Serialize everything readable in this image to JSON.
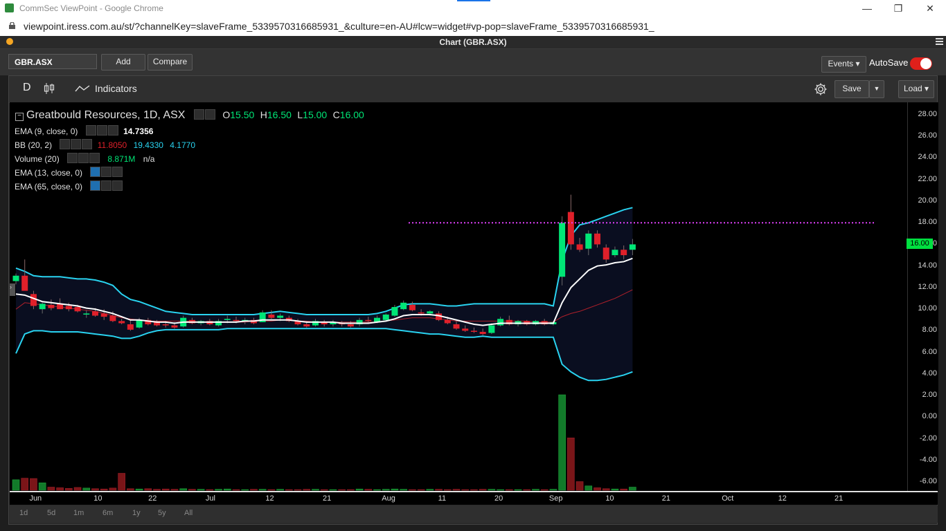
{
  "browser": {
    "title": "CommSec ViewPoint - Google Chrome",
    "url": "viewpoint.iress.com.au/st/?channelKey=slaveFrame_5339570316685931_&culture=en-AU#lcw=widget#vp-pop=slaveFrame_5339570316685931_",
    "minimize": "—",
    "restore": "❐",
    "close": "✕"
  },
  "app": {
    "title": "Chart (GBR.ASX)"
  },
  "toolbar": {
    "symbol": "GBR.ASX",
    "add_label": "Add",
    "compare_label": "Compare",
    "events_label": "Events ▾",
    "autosave_label": "AutoSave",
    "autosave_on": true
  },
  "chart_toolbar": {
    "period": "D",
    "indicators_label": "Indicators",
    "save_label": "Save",
    "save_dropdown": "▼",
    "load_label": "Load ▾"
  },
  "legend": {
    "instrument": "Greatbould Resources, 1D, ASX",
    "ohlc": {
      "o_label": "O",
      "o": "15.50",
      "h_label": "H",
      "h": "16.50",
      "l_label": "L",
      "l": "15.00",
      "c_label": "C",
      "c": "16.00"
    },
    "studies": [
      {
        "name": "EMA (9, close, 0)",
        "values": [
          "14.7356"
        ]
      },
      {
        "name": "BB (20, 2)",
        "values": [
          "11.8050",
          "19.4330",
          "4.1770"
        ]
      },
      {
        "name": "Volume (20)",
        "values": [
          "8.871M",
          "n/a"
        ]
      },
      {
        "name": "EMA (13, close, 0)",
        "values": []
      },
      {
        "name": "EMA (65, close, 0)",
        "values": []
      }
    ],
    "colors": {
      "up": "#00e676",
      "down": "#e0202a",
      "bb_band": "#29d3f0",
      "bb_mid": "#b0202a",
      "ema9": "#ffffff",
      "last_price_line": "#e040fb"
    }
  },
  "chart_data": {
    "type": "candlestick",
    "y_ticks": [
      "28.00",
      "26.00",
      "24.00",
      "22.00",
      "20.00",
      "18.00",
      "16.00",
      "14.00",
      "12.00",
      "10.00",
      "8.00",
      "6.00",
      "4.00",
      "2.00",
      "0.00",
      "-2.00",
      "-4.00",
      "-6.00"
    ],
    "x_ticks": [
      "Jun",
      "10",
      "22",
      "Jul",
      "12",
      "21",
      "Aug",
      "11",
      "20",
      "Sep",
      "10",
      "21",
      "Oct",
      "12",
      "21"
    ],
    "ylim": [
      -7,
      29
    ],
    "last_price": "16.00",
    "reference_line": 18.0,
    "candles": [
      {
        "o": 12.6,
        "h": 13.3,
        "l": 12.3,
        "c": 13.1
      },
      {
        "o": 13.1,
        "h": 14.6,
        "l": 11.8,
        "c": 11.7
      },
      {
        "o": 11.4,
        "h": 11.7,
        "l": 10.0,
        "c": 10.3
      },
      {
        "o": 10.0,
        "h": 10.6,
        "l": 9.6,
        "c": 10.5
      },
      {
        "o": 10.4,
        "h": 10.9,
        "l": 9.9,
        "c": 10.1
      },
      {
        "o": 10.5,
        "h": 11.0,
        "l": 10.0,
        "c": 10.0
      },
      {
        "o": 10.3,
        "h": 10.6,
        "l": 9.8,
        "c": 10.0
      },
      {
        "o": 10.2,
        "h": 10.4,
        "l": 9.7,
        "c": 9.8
      },
      {
        "o": 9.5,
        "h": 9.9,
        "l": 9.2,
        "c": 9.6
      },
      {
        "o": 9.8,
        "h": 10.1,
        "l": 9.3,
        "c": 9.4
      },
      {
        "o": 9.6,
        "h": 10.0,
        "l": 9.0,
        "c": 9.3
      },
      {
        "o": 9.4,
        "h": 9.8,
        "l": 8.8,
        "c": 8.9
      },
      {
        "o": 8.9,
        "h": 9.1,
        "l": 8.6,
        "c": 8.7
      },
      {
        "o": 8.6,
        "h": 9.0,
        "l": 8.0,
        "c": 8.1
      },
      {
        "o": 8.3,
        "h": 9.2,
        "l": 8.2,
        "c": 9.0
      },
      {
        "o": 9.0,
        "h": 9.2,
        "l": 8.5,
        "c": 8.6
      },
      {
        "o": 8.8,
        "h": 9.0,
        "l": 8.4,
        "c": 8.5
      },
      {
        "o": 8.6,
        "h": 8.9,
        "l": 8.3,
        "c": 8.5
      },
      {
        "o": 8.5,
        "h": 8.8,
        "l": 8.2,
        "c": 8.3
      },
      {
        "o": 8.4,
        "h": 9.4,
        "l": 8.3,
        "c": 9.2
      },
      {
        "o": 9.0,
        "h": 9.2,
        "l": 8.6,
        "c": 8.7
      },
      {
        "o": 8.7,
        "h": 9.0,
        "l": 8.5,
        "c": 8.9
      },
      {
        "o": 8.9,
        "h": 9.1,
        "l": 8.5,
        "c": 8.6
      },
      {
        "o": 8.5,
        "h": 9.1,
        "l": 8.4,
        "c": 8.9
      },
      {
        "o": 9.0,
        "h": 9.4,
        "l": 8.7,
        "c": 9.1
      },
      {
        "o": 9.0,
        "h": 9.3,
        "l": 8.7,
        "c": 8.9
      },
      {
        "o": 8.9,
        "h": 9.2,
        "l": 8.6,
        "c": 9.0
      },
      {
        "o": 9.0,
        "h": 9.2,
        "l": 8.6,
        "c": 8.7
      },
      {
        "o": 8.8,
        "h": 9.9,
        "l": 8.8,
        "c": 9.7
      },
      {
        "o": 9.5,
        "h": 9.9,
        "l": 9.1,
        "c": 9.2
      },
      {
        "o": 9.2,
        "h": 9.6,
        "l": 8.9,
        "c": 9.4
      },
      {
        "o": 9.2,
        "h": 9.4,
        "l": 8.8,
        "c": 8.9
      },
      {
        "o": 8.9,
        "h": 9.1,
        "l": 8.5,
        "c": 8.6
      },
      {
        "o": 8.6,
        "h": 8.9,
        "l": 8.3,
        "c": 8.4
      },
      {
        "o": 8.5,
        "h": 9.1,
        "l": 8.4,
        "c": 8.9
      },
      {
        "o": 8.8,
        "h": 9.0,
        "l": 8.4,
        "c": 8.6
      },
      {
        "o": 8.6,
        "h": 9.0,
        "l": 8.4,
        "c": 8.8
      },
      {
        "o": 8.7,
        "h": 8.9,
        "l": 8.4,
        "c": 8.6
      },
      {
        "o": 8.6,
        "h": 8.9,
        "l": 8.3,
        "c": 8.4
      },
      {
        "o": 8.6,
        "h": 9.2,
        "l": 8.4,
        "c": 9.0
      },
      {
        "o": 9.0,
        "h": 9.3,
        "l": 8.7,
        "c": 8.9
      },
      {
        "o": 8.8,
        "h": 9.4,
        "l": 8.7,
        "c": 9.2
      },
      {
        "o": 9.0,
        "h": 9.6,
        "l": 8.9,
        "c": 9.5
      },
      {
        "o": 9.4,
        "h": 10.4,
        "l": 9.3,
        "c": 10.2
      },
      {
        "o": 10.0,
        "h": 10.8,
        "l": 9.9,
        "c": 10.6
      },
      {
        "o": 10.4,
        "h": 10.7,
        "l": 9.8,
        "c": 9.9
      },
      {
        "o": 9.7,
        "h": 10.0,
        "l": 9.4,
        "c": 9.6
      },
      {
        "o": 9.6,
        "h": 9.9,
        "l": 9.4,
        "c": 9.8
      },
      {
        "o": 9.6,
        "h": 9.8,
        "l": 8.9,
        "c": 9.0
      },
      {
        "o": 9.0,
        "h": 9.3,
        "l": 8.6,
        "c": 8.7
      },
      {
        "o": 8.6,
        "h": 8.9,
        "l": 8.1,
        "c": 8.2
      },
      {
        "o": 8.2,
        "h": 8.5,
        "l": 7.9,
        "c": 8.0
      },
      {
        "o": 8.0,
        "h": 8.3,
        "l": 7.8,
        "c": 7.9
      },
      {
        "o": 7.9,
        "h": 8.2,
        "l": 7.6,
        "c": 7.7
      },
      {
        "o": 7.8,
        "h": 8.7,
        "l": 7.7,
        "c": 8.5
      },
      {
        "o": 8.5,
        "h": 9.3,
        "l": 8.4,
        "c": 9.1
      },
      {
        "o": 9.0,
        "h": 9.4,
        "l": 8.5,
        "c": 8.6
      },
      {
        "o": 8.6,
        "h": 9.0,
        "l": 8.4,
        "c": 8.9
      },
      {
        "o": 8.9,
        "h": 9.0,
        "l": 8.5,
        "c": 8.6
      },
      {
        "o": 8.6,
        "h": 9.0,
        "l": 8.5,
        "c": 8.9
      },
      {
        "o": 8.9,
        "h": 9.1,
        "l": 8.5,
        "c": 8.6
      },
      {
        "o": 8.6,
        "h": 8.9,
        "l": 8.5,
        "c": 8.8
      },
      {
        "o": 13.0,
        "h": 18.6,
        "l": 12.2,
        "c": 18.0
      },
      {
        "o": 19.0,
        "h": 20.6,
        "l": 15.5,
        "c": 16.0
      },
      {
        "o": 16.0,
        "h": 16.6,
        "l": 15.3,
        "c": 15.5
      },
      {
        "o": 15.6,
        "h": 17.3,
        "l": 15.0,
        "c": 17.0
      },
      {
        "o": 17.0,
        "h": 17.3,
        "l": 15.7,
        "c": 16.0
      },
      {
        "o": 15.7,
        "h": 16.0,
        "l": 14.3,
        "c": 14.6
      },
      {
        "o": 15.0,
        "h": 15.8,
        "l": 14.8,
        "c": 15.5
      },
      {
        "o": 15.5,
        "h": 15.9,
        "l": 14.6,
        "c": 15.0
      },
      {
        "o": 15.5,
        "h": 16.5,
        "l": 15.0,
        "c": 16.0
      }
    ],
    "volume": [
      3.4,
      3.9,
      3.8,
      2.4,
      1.0,
      0.8,
      0.6,
      0.9,
      0.7,
      0.5,
      0.4,
      0.7,
      5.5,
      0.5,
      0.4,
      0.5,
      0.3,
      0.4,
      0.3,
      0.5,
      0.3,
      0.3,
      0.2,
      0.3,
      0.4,
      0.2,
      0.2,
      0.3,
      0.3,
      0.2,
      0.3,
      0.2,
      0.2,
      0.3,
      0.3,
      0.2,
      0.2,
      0.2,
      0.2,
      0.4,
      0.3,
      0.2,
      0.3,
      0.4,
      0.3,
      0.2,
      0.2,
      0.3,
      0.3,
      0.2,
      0.3,
      0.2,
      0.2,
      0.3,
      0.3,
      0.2,
      0.2,
      0.2,
      0.2,
      0.3,
      0.2,
      0.3,
      31.0,
      17.0,
      2.8,
      1.4,
      0.8,
      0.5,
      0.4,
      0.4,
      1.0
    ],
    "volume_max": 31.0,
    "ema9": [
      11.4,
      11.3,
      11.0,
      10.7,
      10.6,
      10.5,
      10.4,
      10.3,
      10.1,
      10.0,
      9.8,
      9.6,
      9.3,
      9.0,
      9.0,
      8.9,
      8.8,
      8.8,
      8.7,
      8.8,
      8.8,
      8.8,
      8.8,
      8.8,
      8.8,
      8.8,
      8.9,
      8.9,
      9.0,
      9.0,
      9.0,
      9.0,
      8.9,
      8.8,
      8.8,
      8.8,
      8.8,
      8.7,
      8.7,
      8.7,
      8.7,
      8.8,
      8.9,
      9.1,
      9.4,
      9.5,
      9.5,
      9.5,
      9.4,
      9.2,
      9.0,
      8.8,
      8.6,
      8.5,
      8.6,
      8.7,
      8.7,
      8.7,
      8.7,
      8.7,
      8.7,
      8.7,
      10.6,
      12.0,
      12.8,
      13.6,
      14.0,
      14.1,
      14.3,
      14.4,
      14.7
    ],
    "bb_upper": [
      13.8,
      13.5,
      13.1,
      13.0,
      13.0,
      13.0,
      12.9,
      12.8,
      12.8,
      12.7,
      12.5,
      12.2,
      11.4,
      10.9,
      10.7,
      10.4,
      10.1,
      9.8,
      9.7,
      9.6,
      9.5,
      9.5,
      9.5,
      9.5,
      9.5,
      9.5,
      9.5,
      9.5,
      9.6,
      9.7,
      9.8,
      9.7,
      9.6,
      9.5,
      9.5,
      9.5,
      9.5,
      9.5,
      9.5,
      9.5,
      9.5,
      9.6,
      9.8,
      10.1,
      10.4,
      10.5,
      10.5,
      10.5,
      10.4,
      10.3,
      10.3,
      10.4,
      10.5,
      10.5,
      10.5,
      10.5,
      10.5,
      10.5,
      10.5,
      10.5,
      10.5,
      10.3,
      14.5,
      16.8,
      17.8,
      18.0,
      18.3,
      18.6,
      18.9,
      19.2,
      19.4
    ],
    "bb_lower": [
      5.9,
      7.7,
      8.0,
      8.0,
      7.9,
      7.9,
      7.9,
      7.9,
      7.8,
      7.7,
      7.6,
      7.5,
      7.3,
      7.3,
      7.5,
      7.8,
      8.0,
      8.1,
      8.1,
      8.1,
      8.1,
      8.1,
      8.1,
      8.1,
      8.2,
      8.2,
      8.2,
      8.2,
      8.2,
      8.2,
      8.2,
      8.2,
      8.2,
      8.2,
      8.2,
      8.2,
      8.2,
      8.2,
      8.2,
      8.2,
      8.2,
      8.2,
      8.2,
      8.1,
      8.0,
      7.9,
      7.8,
      7.7,
      7.7,
      7.6,
      7.5,
      7.4,
      7.4,
      7.5,
      7.4,
      7.4,
      7.4,
      7.4,
      7.4,
      7.4,
      7.4,
      7.4,
      4.9,
      4.2,
      3.7,
      3.4,
      3.4,
      3.5,
      3.7,
      3.9,
      4.2
    ],
    "bb_mid": [
      10.0,
      10.6,
      10.5,
      10.4,
      10.3,
      10.2,
      10.1,
      10.0,
      9.9,
      9.8,
      9.6,
      9.4,
      9.2,
      9.1,
      9.0,
      8.9,
      8.9,
      8.9,
      8.9,
      8.9,
      8.9,
      8.8,
      8.8,
      8.8,
      8.8,
      8.8,
      8.8,
      8.9,
      8.9,
      8.9,
      9.0,
      9.0,
      8.9,
      8.9,
      8.8,
      8.8,
      8.8,
      8.8,
      8.8,
      8.8,
      8.8,
      8.8,
      8.9,
      9.0,
      9.1,
      9.2,
      9.2,
      9.2,
      9.1,
      9.0,
      8.9,
      8.9,
      8.9,
      8.9,
      8.9,
      8.9,
      8.9,
      8.9,
      8.9,
      8.8,
      8.8,
      8.8,
      9.3,
      9.6,
      9.8,
      10.1,
      10.4,
      10.7,
      11.0,
      11.4,
      11.8
    ]
  },
  "range_buttons": [
    "1d",
    "5d",
    "1m",
    "6m",
    "1y",
    "5y",
    "All"
  ]
}
